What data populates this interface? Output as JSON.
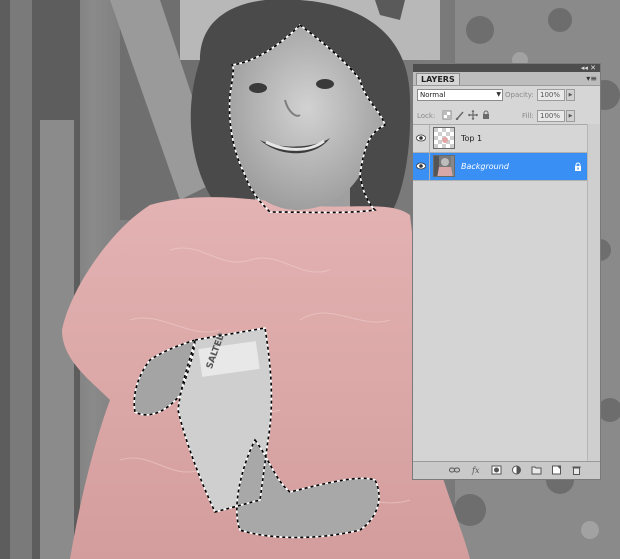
{
  "panel": {
    "title": "LAYERS",
    "menu_glyph": "▾≡",
    "topbar_controls": "◂◂ ✕",
    "blend_mode": "Normal",
    "opacity_label": "Opacity:",
    "opacity_value": "100%",
    "lock_label": "Lock:",
    "fill_label": "Fill:",
    "fill_value": "100%",
    "layers": [
      {
        "name": "Top 1",
        "selected": false
      },
      {
        "name": "Background",
        "selected": true,
        "locked": true
      }
    ],
    "bottom_icons": [
      "link-icon",
      "fx-icon",
      "mask-icon",
      "adjustment-icon",
      "folder-icon",
      "new-layer-icon",
      "trash-icon"
    ]
  },
  "colors": {
    "selection": "#3a8ff4",
    "dress_tint": "#d8a3a3",
    "panel_bg": "#d6d6d6"
  }
}
